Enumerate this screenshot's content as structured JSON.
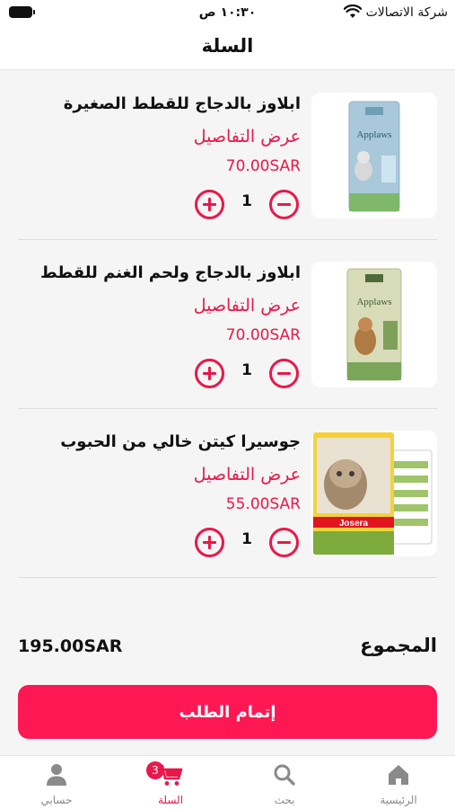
{
  "status_bar": {
    "carrier": "شركة الاتصالات",
    "time": "١٠:٣٠ ص"
  },
  "header": {
    "title": "السلة"
  },
  "cart": {
    "items": [
      {
        "name": "ابلاوز بالدجاج للقطط الصغيرة",
        "details_label": "عرض التفاصيل",
        "price": "70.00SAR",
        "quantity": "1",
        "image_brand": "Applaws",
        "image_color": "#a9c8d9"
      },
      {
        "name": "ابلاوز بالدجاج ولحم الغنم للقطط",
        "details_label": "عرض التفاصيل",
        "price": "70.00SAR",
        "quantity": "1",
        "image_brand": "Applaws",
        "image_color": "#b9c898"
      },
      {
        "name": "جوسيرا كيتن خالي من الحبوب",
        "details_label": "عرض التفاصيل",
        "price": "55.00SAR",
        "quantity": "1",
        "image_brand": "Josera",
        "image_color": "#f3d23c"
      }
    ]
  },
  "summary": {
    "total_label": "المجموع",
    "total_value": "195.00SAR"
  },
  "checkout": {
    "label": "إتمام الطلب"
  },
  "tab_bar": {
    "items": [
      {
        "label": "الرئيسية",
        "icon": "home-icon",
        "active": false
      },
      {
        "label": "بحث",
        "icon": "search-icon",
        "active": false
      },
      {
        "label": "السلة",
        "icon": "cart-icon",
        "active": true,
        "badge": "3"
      },
      {
        "label": "حسابي",
        "icon": "user-icon",
        "active": false
      }
    ]
  },
  "colors": {
    "accent": "#e8184a",
    "button": "#fd1853",
    "background": "#f5f5f5",
    "inactive_tab": "#8a8a8a"
  }
}
